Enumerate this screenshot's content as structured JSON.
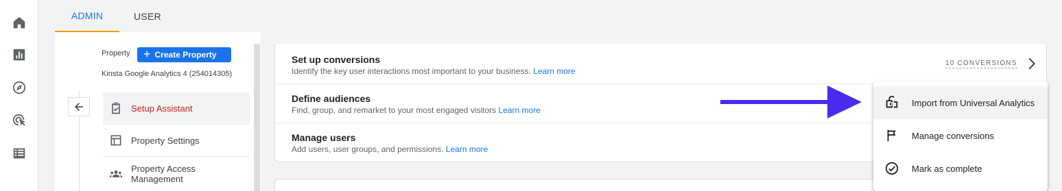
{
  "rail": {
    "icons": [
      "home-icon",
      "reports-icon",
      "explore-icon",
      "advertising-icon",
      "configure-icon"
    ]
  },
  "tabs": [
    {
      "label": "ADMIN",
      "active": true
    },
    {
      "label": "USER",
      "active": false
    }
  ],
  "property_panel": {
    "property_label": "Property",
    "create_button": "Create Property",
    "property_name": "Kinsta Google Analytics 4 (254014305)",
    "menu": [
      {
        "label": "Setup Assistant",
        "icon": "checklist-icon",
        "active": true
      },
      {
        "label": "Property Settings",
        "icon": "layout-icon",
        "active": false
      },
      {
        "label": "Property Access Management",
        "icon": "people-icon",
        "active": false
      }
    ]
  },
  "setup_rows": [
    {
      "title": "Set up conversions",
      "description": "Identify the key user interactions most important to your business.",
      "link": "Learn more"
    },
    {
      "title": "Define audiences",
      "description": "Find, group, and remarket to your most engaged visitors",
      "link": "Learn more"
    },
    {
      "title": "Manage users",
      "description": "Add users, user groups, and permissions.",
      "link": "Learn more"
    }
  ],
  "conversions_link": "10 CONVERSIONS",
  "dropdown": {
    "items": [
      {
        "label": "Import from Universal Analytics",
        "icon": "import-icon"
      },
      {
        "label": "Manage conversions",
        "icon": "flag-icon"
      },
      {
        "label": "Mark as complete",
        "icon": "check-circle-icon"
      }
    ]
  },
  "colors": {
    "accent": "#1a73e8",
    "active_tab_underline": "#f29900",
    "active_menu_text": "#c5221f",
    "annotation_arrow": "#4a2bf0"
  }
}
